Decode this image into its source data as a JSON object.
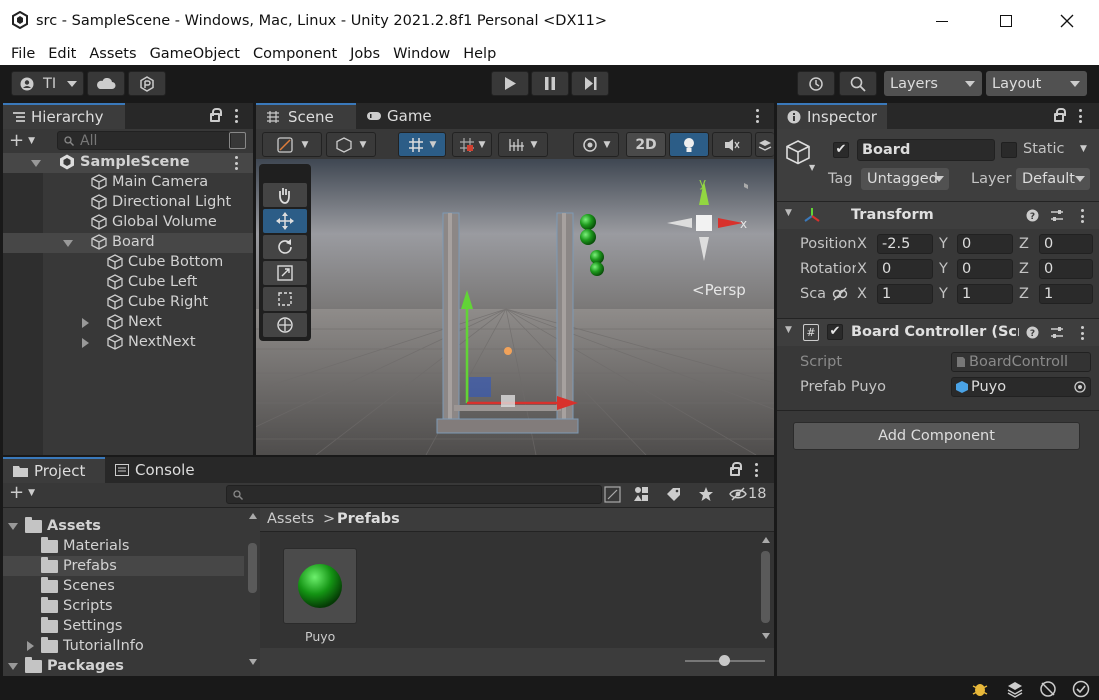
{
  "window": {
    "title": "src - SampleScene - Windows, Mac, Linux - Unity 2021.2.8f1 Personal <DX11>"
  },
  "menu": [
    "File",
    "Edit",
    "Assets",
    "GameObject",
    "Component",
    "Jobs",
    "Window",
    "Help"
  ],
  "toolbar": {
    "account_label": "TI",
    "layers_label": "Layers",
    "layout_label": "Layout"
  },
  "hierarchy": {
    "tab": "Hierarchy",
    "search_placeholder": "All",
    "items": [
      {
        "label": "SampleScene",
        "depth": 0
      },
      {
        "label": "Main Camera",
        "depth": 1
      },
      {
        "label": "Directional Light",
        "depth": 1
      },
      {
        "label": "Global Volume",
        "depth": 1
      },
      {
        "label": "Board",
        "depth": 1
      },
      {
        "label": "Cube Bottom",
        "depth": 2
      },
      {
        "label": "Cube Left",
        "depth": 2
      },
      {
        "label": "Cube Right",
        "depth": 2
      },
      {
        "label": "Next",
        "depth": 2
      },
      {
        "label": "NextNext",
        "depth": 2
      }
    ]
  },
  "scene": {
    "tab_scene": "Scene",
    "tab_game": "Game",
    "mode_2d": "2D",
    "persp_label": "Persp",
    "gizmo_x": "x",
    "gizmo_y": "y"
  },
  "inspector": {
    "tab": "Inspector",
    "object_name": "Board",
    "static_label": "Static",
    "tag_label": "Tag",
    "tag_value": "Untagged",
    "layer_label": "Layer",
    "layer_value": "Default",
    "transform": {
      "title": "Transform",
      "position_label": "Position",
      "rotation_label": "Rotation",
      "scale_label": "Sca",
      "position": {
        "x": "-2.5",
        "y": "0",
        "z": "0"
      },
      "rotation": {
        "x": "0",
        "y": "0",
        "z": "0"
      },
      "scale": {
        "x": "1",
        "y": "1",
        "z": "1"
      },
      "axis_x": "X",
      "axis_y": "Y",
      "axis_z": "Z"
    },
    "board_controller": {
      "title": "Board Controller (Scrip",
      "script_label": "Script",
      "script_value": "BoardControll",
      "prefab_label": "Prefab Puyo",
      "prefab_value": "Puyo"
    },
    "add_component": "Add Component"
  },
  "project": {
    "tab_project": "Project",
    "tab_console": "Console",
    "hidden_count": "18",
    "tree": [
      {
        "label": "Assets",
        "depth": 0,
        "expanded": true,
        "bold": true
      },
      {
        "label": "Materials",
        "depth": 1
      },
      {
        "label": "Prefabs",
        "depth": 1,
        "selected": true
      },
      {
        "label": "Scenes",
        "depth": 1
      },
      {
        "label": "Scripts",
        "depth": 1
      },
      {
        "label": "Settings",
        "depth": 1
      },
      {
        "label": "TutorialInfo",
        "depth": 1,
        "collapsed": true
      },
      {
        "label": "Packages",
        "depth": 0,
        "expanded": true,
        "bold": true
      }
    ],
    "breadcrumb_root": "Assets",
    "breadcrumb_current": "Prefabs",
    "assets": [
      {
        "label": "Puyo"
      }
    ]
  },
  "colors": {
    "accent": "#3a79bb",
    "selection": "#2c5d87",
    "panel": "#383838"
  }
}
